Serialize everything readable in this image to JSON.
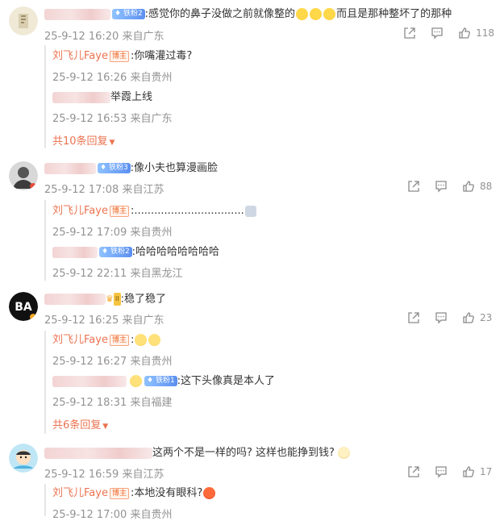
{
  "comments": [
    {
      "badge": "铁粉2",
      "text": ":感觉你的鼻子没做之前就像整的",
      "text_tail": "而且是那种整坏了的那种",
      "time": "25-9-12 16:20 来自广东",
      "likes": "118",
      "replies": [
        {
          "author": "刘飞儿Faye",
          "tag": "博主",
          "text": ":你嘴灌过毒?",
          "time": "25-9-12 16:26 来自贵州"
        },
        {
          "text": "举霞上线",
          "time": "25-9-12 16:53 来自广东"
        }
      ],
      "more": "共10条回复"
    },
    {
      "badge": "铁粉3",
      "text": ":像小夫也算漫画脸",
      "time": "25-9-12 17:08 来自江苏",
      "likes": "88",
      "replies": [
        {
          "author": "刘飞儿Faye",
          "tag": "博主",
          "text": ":.................................",
          "time": "25-9-12 17:09 来自贵州"
        },
        {
          "badge": "铁粉2",
          "text": ":哈哈哈哈哈哈哈哈",
          "time": "25-9-12 22:11 来自黑龙江"
        }
      ]
    },
    {
      "avatar_text": "BA",
      "vip": "II",
      "text": ":稳了稳了",
      "time": "25-9-12 16:25 来自广东",
      "likes": "23",
      "replies": [
        {
          "author": "刘飞儿Faye",
          "tag": "博主",
          "text": ":",
          "time": "25-9-12 16:27 来自贵州"
        },
        {
          "badge": "铁粉1",
          "text": ":这下头像真是本人了",
          "time": "25-9-12 18:31 来自福建"
        }
      ],
      "more": "共6条回复"
    },
    {
      "text": "这两个不是一样的吗? 这样也能挣到钱?",
      "time": "25-9-12 16:59 来自江苏",
      "likes": "17",
      "replies": [
        {
          "author": "刘飞儿Faye",
          "tag": "博主",
          "text": ":本地没有眼科?",
          "time": "25-9-12 17:00 来自贵州"
        }
      ]
    }
  ],
  "colors": {
    "accent": "#eb7350",
    "meta": "#939393"
  },
  "icons": [
    "share-icon",
    "comment-icon",
    "like-icon"
  ]
}
